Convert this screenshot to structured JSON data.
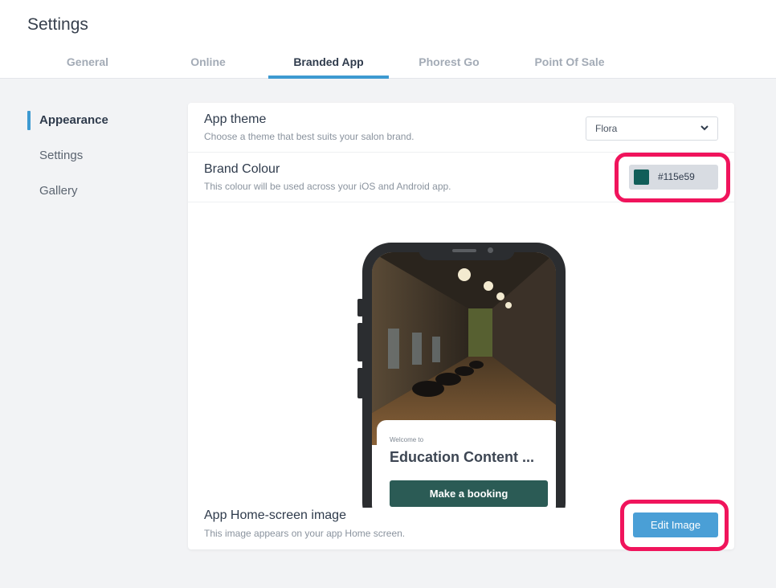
{
  "page": {
    "title": "Settings"
  },
  "tabs": [
    {
      "label": "General"
    },
    {
      "label": "Online"
    },
    {
      "label": "Branded App"
    },
    {
      "label": "Phorest Go"
    },
    {
      "label": "Point Of Sale"
    }
  ],
  "active_tab": "Branded App",
  "sidebar": {
    "items": [
      {
        "label": "Appearance"
      },
      {
        "label": "Settings"
      },
      {
        "label": "Gallery"
      }
    ],
    "active": "Appearance"
  },
  "app_theme": {
    "title": "App theme",
    "description": "Choose a theme that best suits your salon brand.",
    "selected": "Flora"
  },
  "brand_colour": {
    "title": "Brand Colour",
    "description": "This colour will be used across your iOS and Android app.",
    "value": "#115e59",
    "swatch_color": "#115e59"
  },
  "phone_preview": {
    "welcome_text": "Welcome to",
    "salon_name": "Education Content ...",
    "booking_button": "Make a booking",
    "button_color": "#2b5b55"
  },
  "home_image": {
    "title": "App Home-screen image",
    "description": "This image appears on your app Home screen.",
    "edit_button": "Edit Image"
  },
  "colors": {
    "accent": "#3d9ad1",
    "highlight": "#f0145c",
    "edit_button": "#4a9fd6"
  },
  "icons": {
    "select_chevron": "chevron-down-icon"
  }
}
